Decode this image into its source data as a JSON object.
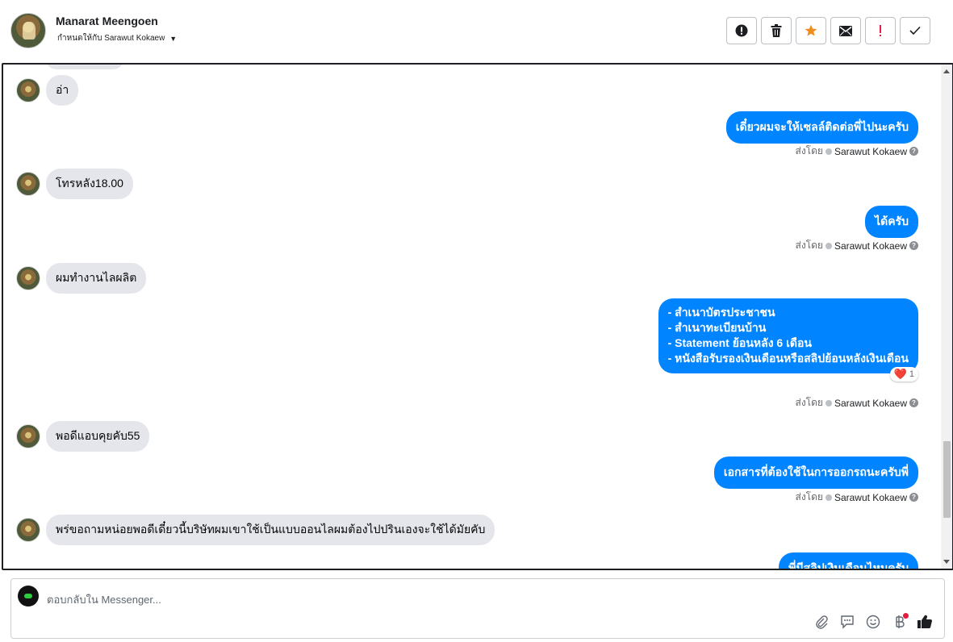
{
  "header": {
    "contact_name": "Manarat Meengoen",
    "assigned_to": "กำหนดให้กับ Sarawut Kokaew",
    "actions": [
      {
        "name": "report-icon",
        "color": "#1c1e21"
      },
      {
        "name": "trash-icon",
        "color": "#1c1e21"
      },
      {
        "name": "star-icon",
        "color": "#f08c1e"
      },
      {
        "name": "mail-icon",
        "color": "#1c1e21"
      },
      {
        "name": "exclamation-icon",
        "color": "#e41e3f"
      },
      {
        "name": "check-icon",
        "color": "#1c1e21"
      }
    ]
  },
  "messages": [
    {
      "dir": "in",
      "text": "อ่า"
    },
    {
      "dir": "out",
      "text": "เดี๋ยวผมจะให้เซลล์ติดต่อพี่ไปนะครับ",
      "sent_by_label": "ส่งโดย",
      "sender": "Sarawut Kokaew"
    },
    {
      "dir": "in",
      "text": "โทรหลัง18.00"
    },
    {
      "dir": "out",
      "text": "ได้ครับ",
      "sent_by_label": "ส่งโดย",
      "sender": "Sarawut Kokaew"
    },
    {
      "dir": "in",
      "text": "ผมทำงานไลผลิต"
    },
    {
      "dir": "out",
      "lines": [
        "- สำเนาบัตรประชาชน",
        "- สำเนาทะเบียนบ้าน",
        "- Statement ย้อนหลัง 6 เดือน",
        "- หนังสือรับรองเงินเดือนหรือสลิปย้อนหลังเงินเดือน"
      ],
      "reaction": {
        "emoji": "❤️",
        "count": "1"
      },
      "sent_by_label": "ส่งโดย",
      "sender": "Sarawut Kokaew"
    },
    {
      "dir": "in",
      "text": "พอดีแอบคุยคับ55"
    },
    {
      "dir": "out",
      "text": "เอกสารที่ต้องใช้ในการออกรถนะครับพี่",
      "sent_by_label": "ส่งโดย",
      "sender": "Sarawut Kokaew"
    },
    {
      "dir": "in",
      "text": "พร่ขอถามหน่อยพอดีเดี๋ยวนี้บริษัทผมเขาใช้เป็นแบบออนไลผมต้องไปปรินเองจะใช้ได้มัยคับ"
    },
    {
      "dir": "out",
      "text": "พี่มีสลิปเงินเดือนไหมครับ"
    }
  ],
  "composer": {
    "placeholder": "ตอบกลับใน Messenger...",
    "tools": [
      "attachment-icon",
      "saved-reply-icon",
      "emoji-icon",
      "baht-icon",
      "like-icon"
    ]
  }
}
